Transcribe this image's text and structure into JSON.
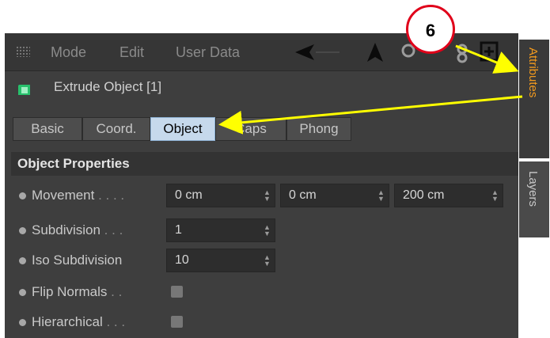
{
  "menu": {
    "items": [
      "Mode",
      "Edit",
      "User Data"
    ],
    "icons": [
      "back-arrow-icon",
      "up-arrow-icon",
      "search-icon",
      "lock-icon",
      "link-icon",
      "new-panel-icon"
    ]
  },
  "object": {
    "icon": "extrude-object-icon",
    "title": "Extrude Object [1]"
  },
  "tabs": [
    {
      "label": "Basic",
      "active": false
    },
    {
      "label": "Coord.",
      "active": false
    },
    {
      "label": "Object",
      "active": true
    },
    {
      "label": "Caps",
      "active": false
    },
    {
      "label": "Phong",
      "active": false
    }
  ],
  "section": {
    "title": "Object Properties"
  },
  "properties": {
    "movement": {
      "label": "Movement",
      "dots": " . . . .",
      "values": [
        "0 cm",
        "0 cm",
        "200 cm"
      ]
    },
    "subdivision": {
      "label": "Subdivision",
      "dots": " . . .",
      "value": "1"
    },
    "iso_subdivision": {
      "label": "Iso Subdivision",
      "value": "10"
    },
    "flip_normals": {
      "label": "Flip Normals",
      "dots": " . .",
      "checked": false
    },
    "hierarchical": {
      "label": "Hierarchical",
      "dots": " . . .",
      "checked": false
    }
  },
  "side_tabs": [
    {
      "label": "Attributes",
      "active": true
    },
    {
      "label": "Layers",
      "active": false
    }
  ],
  "annotation": {
    "number": "6"
  },
  "colors": {
    "panel_bg": "#3e3e3e",
    "active_tab": "#c6d9ec",
    "active_side_tab_text": "#f29a1e",
    "annotation_arrow": "#ffff00",
    "annotation_circle": "#e0001a"
  }
}
